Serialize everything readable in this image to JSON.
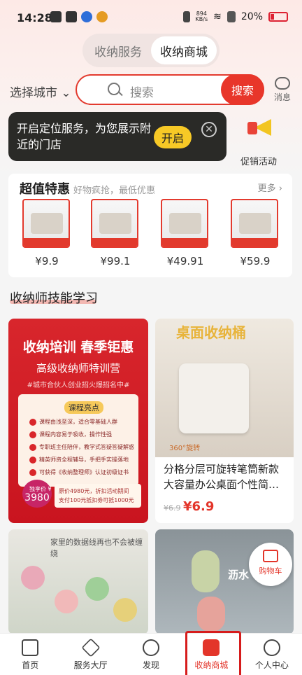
{
  "status_bar": {
    "time": "14:28",
    "net_speed": "894",
    "net_unit": "KB/s",
    "battery": "20%"
  },
  "tabs": [
    {
      "label": "收纳服务",
      "active": false
    },
    {
      "label": "收纳商城",
      "active": true
    }
  ],
  "search": {
    "city": "选择城市",
    "placeholder": "搜索",
    "button": "搜索"
  },
  "message": {
    "label": "消息"
  },
  "location_popup": {
    "text": "开启定位服务，为您展示附近的门店",
    "button": "开启"
  },
  "promo": {
    "label": "促销活动"
  },
  "deals": {
    "title": "超值特惠",
    "subtitle": "好物疯抢，最低优惠",
    "more": "更多",
    "items": [
      {
        "price": "¥9.9"
      },
      {
        "price": "¥99.1"
      },
      {
        "price": "¥49.91"
      },
      {
        "price": "¥59.9"
      }
    ]
  },
  "section": {
    "title": "收纳师技能学习"
  },
  "course_card": {
    "title": "收纳培训 春季钜惠",
    "subtitle": "高级收纳师特训营",
    "tag": "#城市合伙人创业招火爆招名中#",
    "panel_title": "课程亮点",
    "points": [
      "课程由浅至深，适合零基础人群",
      "课程内容易于吸收，操作性强",
      "专职班主任陪伴，教学式答疑答疑解惑",
      "精英师资全程辅导，手把手实操落地",
      "可获得《收纳整理师》认证初级证书"
    ],
    "price_label": "独享价 ¥",
    "price": "3980",
    "promo_line1": "原价4980元，折扣活动期间",
    "promo_line2": "支付100元抵扣劵可抵1000元"
  },
  "product_card": {
    "banner": "桌面收纳桶",
    "badge": "360°旋转",
    "name": "分格分层可旋转笔筒新款大容量办公桌面个性简…",
    "old_price": "¥6.9",
    "new_price": "¥6.9"
  },
  "bottom_left_card": {
    "text": "家里的数据线再也不会被缠绕"
  },
  "bottom_right_card": {
    "text": "沥水"
  },
  "cart": {
    "label": "购物车"
  },
  "nav": [
    {
      "label": "首页",
      "icon": "home-icon"
    },
    {
      "label": "服务大厅",
      "icon": "cube-icon"
    },
    {
      "label": "发现",
      "icon": "planet-icon"
    },
    {
      "label": "收纳商城",
      "icon": "shopping-bag-icon",
      "active": true
    },
    {
      "label": "个人中心",
      "icon": "user-icon"
    }
  ],
  "colors": {
    "accent": "#e3352a",
    "popup_bg": "#2a2a27",
    "open_button": "#f7c926"
  }
}
